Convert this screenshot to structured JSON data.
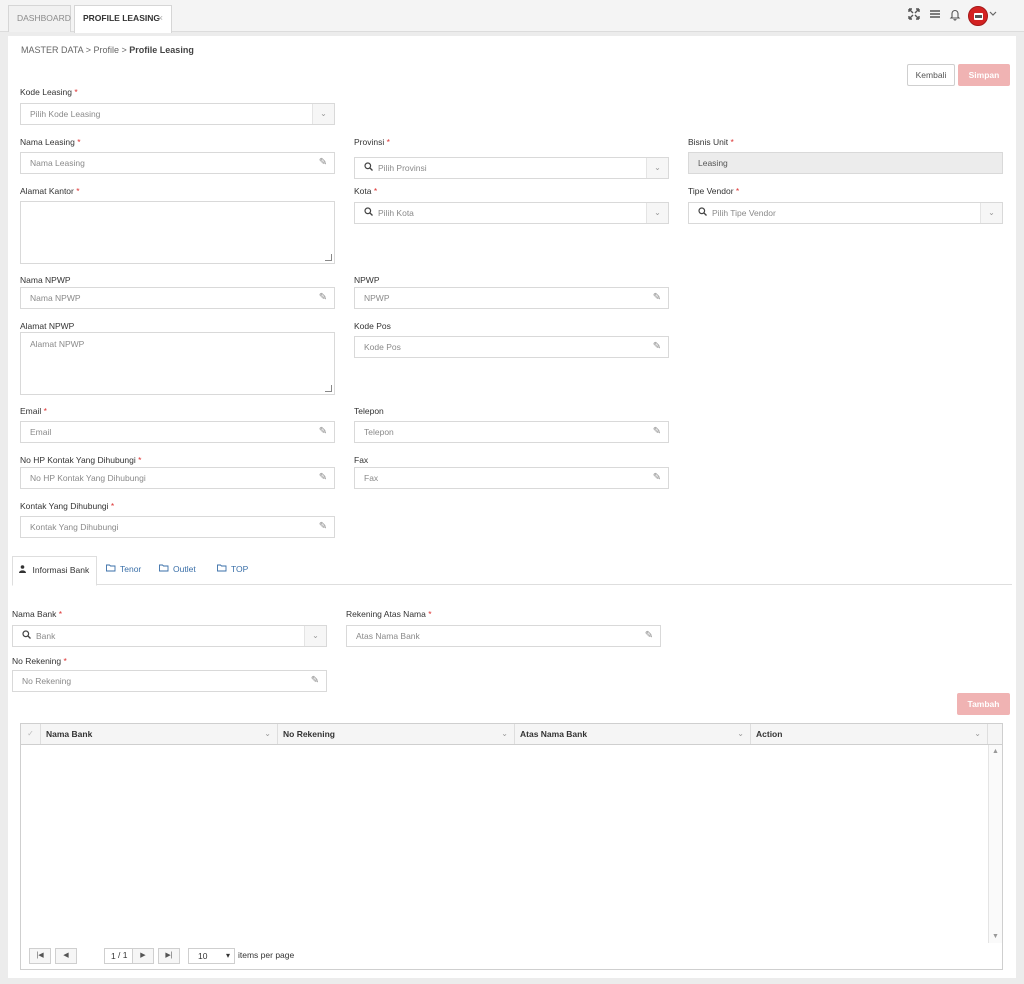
{
  "topbar": {
    "tabs": [
      {
        "label": "DASHBOARD"
      },
      {
        "label": "PROFILE LEASING",
        "close": "×"
      }
    ]
  },
  "breadcrumb": {
    "root": "MASTER DATA",
    "sep": ">",
    "mid": "Profile",
    "current": "Profile Leasing"
  },
  "actions": {
    "back": "Kembali",
    "save": "Simpan",
    "add": "Tambah"
  },
  "form": {
    "kode_leasing": {
      "label": "Kode Leasing",
      "placeholder": "Pilih Kode Leasing"
    },
    "nama_leasing": {
      "label": "Nama Leasing",
      "placeholder": "Nama Leasing"
    },
    "provinsi": {
      "label": "Provinsi",
      "placeholder": "Pilih Provinsi"
    },
    "bisnis_unit": {
      "label": "Bisnis Unit",
      "value": "Leasing"
    },
    "alamat_kantor": {
      "label": "Alamat Kantor",
      "placeholder": ""
    },
    "kota": {
      "label": "Kota",
      "placeholder": "Pilih Kota"
    },
    "tipe_vendor": {
      "label": "Tipe Vendor",
      "placeholder": "Pilih Tipe Vendor"
    },
    "nama_npwp": {
      "label": "Nama NPWP",
      "placeholder": "Nama NPWP"
    },
    "npwp": {
      "label": "NPWP",
      "placeholder": "NPWP"
    },
    "alamat_npwp": {
      "label": "Alamat NPWP",
      "placeholder": "Alamat NPWP"
    },
    "kode_pos": {
      "label": "Kode Pos",
      "placeholder": "Kode Pos"
    },
    "email": {
      "label": "Email",
      "placeholder": "Email"
    },
    "telepon": {
      "label": "Telepon",
      "placeholder": "Telepon"
    },
    "no_hp": {
      "label": "No HP Kontak Yang Dihubungi",
      "placeholder": "No HP Kontak Yang Dihubungi"
    },
    "fax": {
      "label": "Fax",
      "placeholder": "Fax"
    },
    "kontak": {
      "label": "Kontak Yang Dihubungi",
      "placeholder": "Kontak Yang Dihubungi"
    },
    "required_mark": "*"
  },
  "subtabs": [
    {
      "label": "Informasi Bank",
      "icon": "user-icon"
    },
    {
      "label": "Tenor",
      "icon": "folder-icon"
    },
    {
      "label": "Outlet",
      "icon": "folder-icon"
    },
    {
      "label": "TOP",
      "icon": "folder-icon"
    }
  ],
  "bank": {
    "nama_bank": {
      "label": "Nama Bank",
      "placeholder": "Bank"
    },
    "rekening_atas_nama": {
      "label": "Rekening Atas Nama",
      "placeholder": "Atas Nama Bank"
    },
    "no_rekening": {
      "label": "No Rekening",
      "placeholder": "No Rekening"
    }
  },
  "grid": {
    "columns": [
      "Nama Bank",
      "No Rekening",
      "Atas Nama Bank",
      "Action"
    ],
    "pager": {
      "page": "1",
      "of_label": "/ 1",
      "page_size": "10",
      "items_label": "items per page"
    }
  },
  "colors": {
    "accent_pink": "#f0b3b3",
    "link_blue": "#3a6fa8",
    "required_red": "#dd3333",
    "avatar_red": "#d32222"
  }
}
